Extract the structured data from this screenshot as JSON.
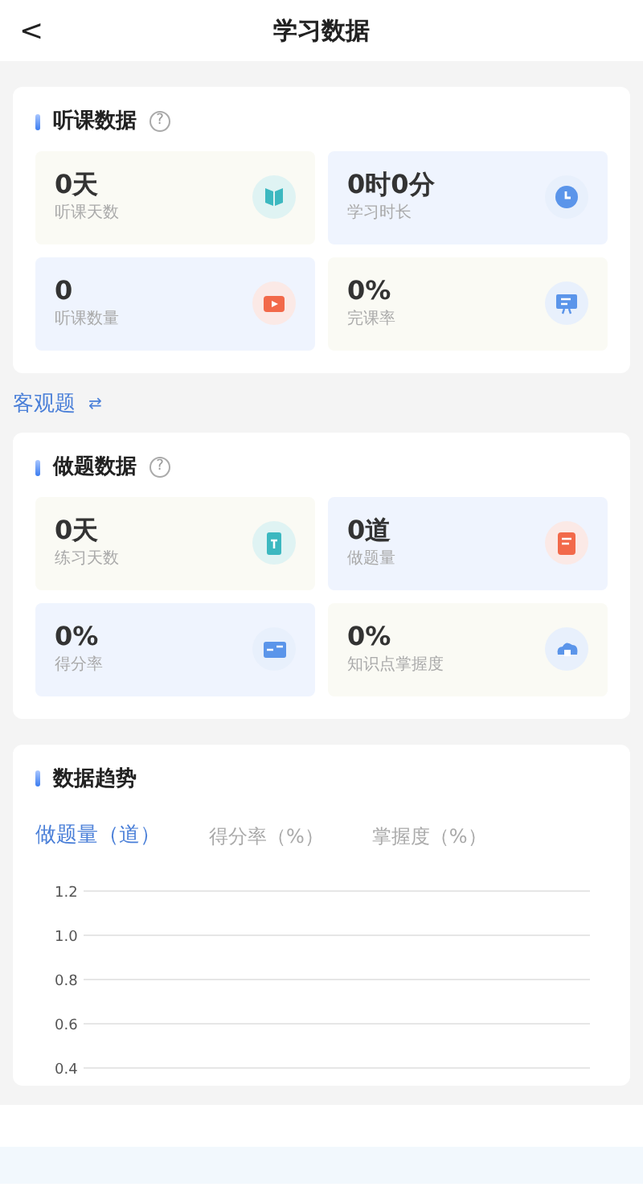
{
  "header": {
    "back": "<",
    "title": "学习数据"
  },
  "listening": {
    "title": "听课数据",
    "help": "?",
    "stats": [
      {
        "value": "0天",
        "label": "听课天数",
        "color": "#fafaf4"
      },
      {
        "value": "0时0分",
        "label": "学习时长",
        "color": "#eff4fe"
      },
      {
        "value": "0",
        "label": "听课数量",
        "color": "#eff4fe"
      },
      {
        "value": "0%",
        "label": "完课率",
        "color": "#fafaf4"
      }
    ]
  },
  "switcher": {
    "label": "客观题",
    "icon": "⇄"
  },
  "practice": {
    "title": "做题数据",
    "help": "?",
    "stats": [
      {
        "value": "0天",
        "label": "练习天数",
        "color": "#fafaf4"
      },
      {
        "value": "0道",
        "label": "做题量",
        "color": "#eff4fe"
      },
      {
        "value": "0%",
        "label": "得分率",
        "color": "#eff4fe"
      },
      {
        "value": "0%",
        "label": "知识点掌握度",
        "color": "#fafaf4"
      }
    ]
  },
  "trend": {
    "title": "数据趋势",
    "tabs": [
      {
        "label": "做题量（道）",
        "selected": true
      },
      {
        "label": "得分率（%）",
        "selected": false
      },
      {
        "label": "掌握度（%）",
        "selected": false
      }
    ],
    "chart_data": {
      "type": "line",
      "categories": [
        null
      ],
      "grid": true,
      "ylim": [
        0.4,
        1.2
      ],
      "yticks": [
        {
          "value": 1.2,
          "label": "1.2"
        },
        {
          "value": 1,
          "label": "1.0"
        },
        {
          "value": 0.8,
          "label": "0.8"
        },
        {
          "value": 0.6,
          "label": "0.6"
        },
        {
          "value": 0.4,
          "label": "0.4"
        }
      ]
    }
  }
}
